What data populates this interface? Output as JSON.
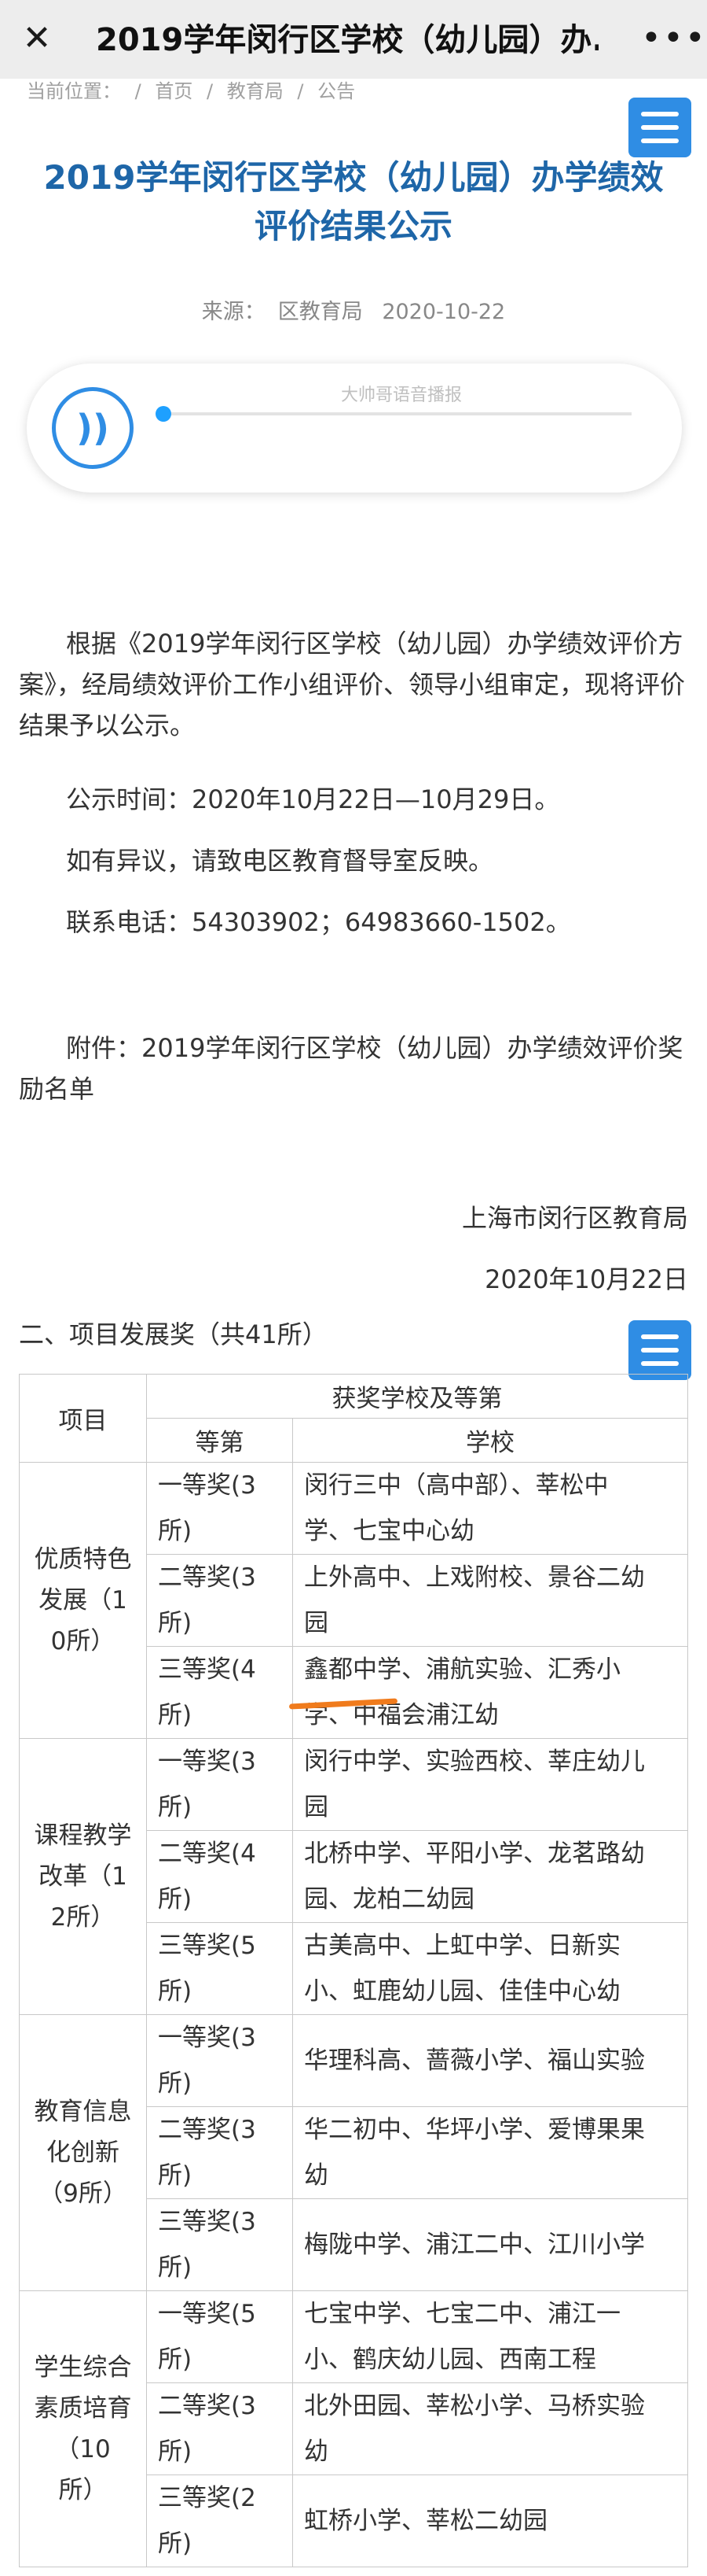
{
  "topbar": {
    "close_icon": "close-icon",
    "title": "2019学年闵行区学校（幼儿园）办...",
    "more_icon": "more-icon"
  },
  "breadcrumb": {
    "prefix": "当前位置：",
    "sep": "/",
    "home": "首页",
    "dept": "教育局",
    "section": "公告"
  },
  "article": {
    "title_line1": "2019学年闵行区学校（幼儿园）办学绩效",
    "title_line2": "评价结果公示",
    "source_label": "来源：",
    "source": "区教育局",
    "date": "2020-10-22"
  },
  "player": {
    "icon": "audio-play-icon",
    "hint": "大帅哥语音播报"
  },
  "body": {
    "p1_line1": "根据《2019学年闵行区学校（幼儿园）办学绩效评价方",
    "p1_line2": "案》，经局绩效评价工作小组评价、领导小组审定，现将评价",
    "p1_line3": "结果予以公示。",
    "p2": "公示时间：2020年10月22日—10月29日。",
    "p3": "如有异议，请致电区教育督导室反映。",
    "p4": "联系电话：54303902；64983660-1502。",
    "p5_line1": "附件：2019学年闵行区学校（幼儿园）办学绩效评价奖",
    "p5_line2": "励名单",
    "signature": "上海市闵行区教育局",
    "sign_date": "2020年10月22日"
  },
  "section2": {
    "heading": "二、项目发展奖（共41所）"
  },
  "table": {
    "h_project": "项目",
    "h_awards": "获奖学校及等第",
    "h_level": "等第",
    "h_school": "学校",
    "groups": [
      {
        "category_lines": [
          "优质特色",
          "发展（1",
          "0所）"
        ],
        "rows": [
          {
            "level": [
              "一等奖(3",
              "所)"
            ],
            "schools": [
              "闵行三中（高中部）、莘松中",
              "学、七宝中心幼"
            ]
          },
          {
            "level": [
              "二等奖(3",
              "所)"
            ],
            "schools": [
              "上外高中、上戏附校、景谷二幼",
              "园"
            ]
          },
          {
            "level": [
              "三等奖(4",
              "所)"
            ],
            "schools": [
              "鑫都中学、浦航实验、汇秀小",
              "学、中福会浦江幼"
            ]
          }
        ]
      },
      {
        "category_lines": [
          "课程教学",
          "改革（1",
          "2所）"
        ],
        "rows": [
          {
            "level": [
              "一等奖(3",
              "所)"
            ],
            "schools": [
              "闵行中学、实验西校、莘庄幼儿",
              "园"
            ]
          },
          {
            "level": [
              "二等奖(4",
              "所)"
            ],
            "schools": [
              "北桥中学、平阳小学、龙茗路幼",
              "园、龙柏二幼园"
            ]
          },
          {
            "level": [
              "三等奖(5",
              "所)"
            ],
            "schools": [
              "古美高中、上虹中学、日新实",
              "小、虹鹿幼儿园、佳佳中心幼"
            ]
          }
        ]
      },
      {
        "category_lines": [
          "教育信息",
          "化创新",
          "（9所）"
        ],
        "rows": [
          {
            "level": [
              "一等奖(3",
              "所)"
            ],
            "schools": [
              "华理科高、蔷薇小学、福山实验"
            ]
          },
          {
            "level": [
              "二等奖(3",
              "所)"
            ],
            "schools": [
              "华二初中、华坪小学、爱博果果",
              "幼"
            ]
          },
          {
            "level": [
              "三等奖(3",
              "所)"
            ],
            "schools": [
              "梅陇中学、浦江二中、江川小学"
            ]
          }
        ]
      },
      {
        "category_lines": [
          "学生综合",
          "素质培育",
          "（10",
          "所）"
        ],
        "rows": [
          {
            "level": [
              "一等奖(5",
              "所)"
            ],
            "schools": [
              "七宝中学、七宝二中、浦江一",
              "小、鹤庆幼儿园、西南工程"
            ]
          },
          {
            "level": [
              "二等奖(3",
              "所)"
            ],
            "schools": [
              "北外田园、莘松小学、马桥实验",
              "幼"
            ]
          },
          {
            "level": [
              "三等奖(2",
              "所)"
            ],
            "schools": [
              "虹桥小学、莘松二幼园"
            ]
          }
        ]
      }
    ]
  },
  "colors": {
    "title_blue": "#1e66a8",
    "menu_blue": "#2f8de4",
    "highlight_orange": "#f07b1c"
  }
}
